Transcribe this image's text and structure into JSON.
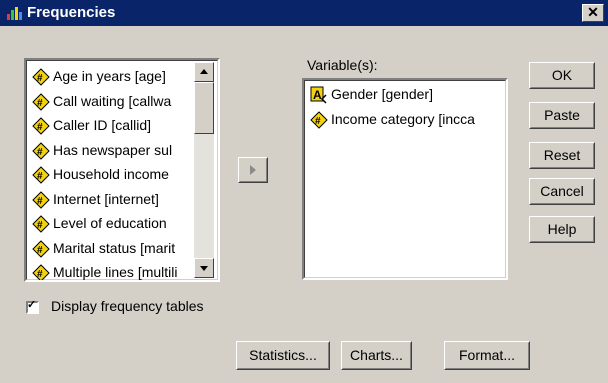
{
  "window": {
    "title": "Frequencies",
    "close_symbol": "✕"
  },
  "source_list": {
    "items": [
      {
        "label": "Age in years [age]",
        "icon": "scale-variable-icon"
      },
      {
        "label": "Call waiting [callwa",
        "icon": "scale-variable-icon"
      },
      {
        "label": "Caller ID [callid]",
        "icon": "scale-variable-icon"
      },
      {
        "label": "Has newspaper sul",
        "icon": "scale-variable-icon"
      },
      {
        "label": "Household income",
        "icon": "scale-variable-icon"
      },
      {
        "label": "Internet [internet]",
        "icon": "scale-variable-icon"
      },
      {
        "label": "Level of education",
        "icon": "scale-variable-icon"
      },
      {
        "label": "Marital status [marit",
        "icon": "scale-variable-icon"
      },
      {
        "label": "Multiple lines [multili",
        "icon": "scale-variable-icon"
      }
    ]
  },
  "target": {
    "label": "Variable(s):",
    "items": [
      {
        "label": "Gender [gender]",
        "icon": "string-variable-icon"
      },
      {
        "label": "Income category [incca",
        "icon": "scale-variable-icon"
      }
    ]
  },
  "buttons": {
    "ok": "OK",
    "paste": "Paste",
    "reset": "Reset",
    "cancel": "Cancel",
    "help": "Help",
    "statistics": "Statistics...",
    "charts": "Charts...",
    "format": "Format..."
  },
  "options": {
    "display_tables_label": "Display frequency tables",
    "display_tables_checked": true,
    "check_symbol": "✓"
  },
  "colors": {
    "titlebar": "#0a246a",
    "dialog_face": "#d4d0c8",
    "scale_icon_fill": "#f3d20f"
  }
}
